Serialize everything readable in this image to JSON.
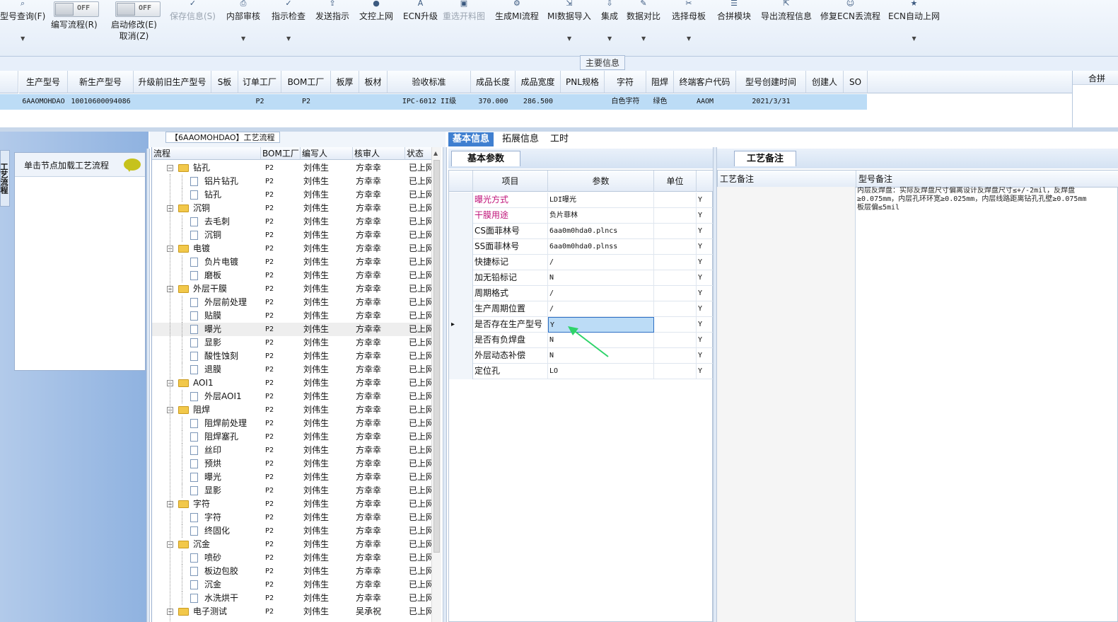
{
  "toolbar": {
    "items": [
      {
        "label": "型号查询(F)",
        "icon": "search-icon",
        "dropdown": true,
        "disabled": false
      },
      {
        "label": "编写流程(R)",
        "icon": "toggle-switch",
        "dropdown": false,
        "disabled": false,
        "toggle": "OFF"
      },
      {
        "label": "启动修改(E)",
        "label2": "取消(Z)",
        "icon": "toggle-switch",
        "dropdown": false,
        "disabled": false,
        "toggle": "OFF"
      },
      {
        "label": "保存信息(S)",
        "icon": "check-icon",
        "dropdown": false,
        "disabled": true
      },
      {
        "label": "内部审核",
        "icon": "print-icon",
        "dropdown": true,
        "disabled": false
      },
      {
        "label": "指示检查",
        "icon": "check-icon",
        "dropdown": true,
        "disabled": false
      },
      {
        "label": "发送指示",
        "icon": "upload-icon",
        "dropdown": false,
        "disabled": false
      },
      {
        "label": "文控上网",
        "icon": "lock-icon",
        "dropdown": false,
        "disabled": false
      },
      {
        "label": "ECN升级",
        "icon": "font-icon",
        "dropdown": false,
        "disabled": false
      },
      {
        "label": "重选开料图",
        "icon": "image-icon",
        "dropdown": false,
        "disabled": true
      },
      {
        "label": "生成MI流程",
        "icon": "settings-icon",
        "dropdown": false,
        "disabled": false
      },
      {
        "label": "MI数据导入",
        "icon": "import-icon",
        "dropdown": true,
        "disabled": false
      },
      {
        "label": "集成",
        "icon": "download-icon",
        "dropdown": true,
        "disabled": false
      },
      {
        "label": "数据对比",
        "icon": "pin-icon",
        "dropdown": true,
        "disabled": false
      },
      {
        "label": "选择母板",
        "icon": "tool-icon",
        "dropdown": true,
        "disabled": false
      },
      {
        "label": "合拼模块",
        "icon": "list-icon",
        "dropdown": false,
        "disabled": false
      },
      {
        "label": "导出流程信息",
        "icon": "export-icon",
        "dropdown": false,
        "disabled": false
      },
      {
        "label": "修复ECN丢流程",
        "icon": "smile-icon",
        "dropdown": false,
        "disabled": false
      },
      {
        "label": "ECN自动上网",
        "icon": "star-icon",
        "dropdown": true,
        "disabled": false
      }
    ]
  },
  "main_info_label": "主要信息",
  "top_grid": {
    "headers": [
      "生产型号",
      "新生产型号",
      "升级前旧生产型号",
      "S板",
      "订单工厂",
      "BOM工厂",
      "板厚",
      "板材",
      "验收标准",
      "成品长度",
      "成品宽度",
      "PNL规格",
      "字符",
      "阻焊",
      "终端客户代码",
      "型号创建时间",
      "创建人",
      "SO"
    ],
    "row": [
      "6AAOMOHDAO",
      "10010600094086",
      "",
      "",
      "P2",
      "P2",
      "",
      "",
      "IPC-6012 II级",
      "370.000",
      "286.500",
      "",
      "白色字符",
      "绿色",
      "AAOM",
      "2021/3/31",
      "",
      ""
    ]
  },
  "right_stub_header": "合拼",
  "left_panel": {
    "vertical_tab": "工艺流程",
    "load_hint": "单击节点加载工艺流程"
  },
  "tree_panel": {
    "title": "【6AAOMOHDAO】工艺流程",
    "headers": [
      "流程",
      "BOM工厂",
      "编写人",
      "核审人",
      "状态"
    ],
    "rows": [
      {
        "name": "钻孔",
        "level": 0,
        "bom": "P2",
        "writer": "刘伟生",
        "reviewer": "方幸幸",
        "status": "已上网"
      },
      {
        "name": "铝片钻孔",
        "level": 1,
        "bom": "P2",
        "writer": "刘伟生",
        "reviewer": "方幸幸",
        "status": "已上网"
      },
      {
        "name": "钻孔",
        "level": 1,
        "bom": "P2",
        "writer": "刘伟生",
        "reviewer": "方幸幸",
        "status": "已上网"
      },
      {
        "name": "沉铜",
        "level": 0,
        "bom": "P2",
        "writer": "刘伟生",
        "reviewer": "方幸幸",
        "status": "已上网"
      },
      {
        "name": "去毛刺",
        "level": 1,
        "bom": "P2",
        "writer": "刘伟生",
        "reviewer": "方幸幸",
        "status": "已上网"
      },
      {
        "name": "沉铜",
        "level": 1,
        "bom": "P2",
        "writer": "刘伟生",
        "reviewer": "方幸幸",
        "status": "已上网"
      },
      {
        "name": "电镀",
        "level": 0,
        "bom": "P2",
        "writer": "刘伟生",
        "reviewer": "方幸幸",
        "status": "已上网"
      },
      {
        "name": "负片电镀",
        "level": 1,
        "bom": "P2",
        "writer": "刘伟生",
        "reviewer": "方幸幸",
        "status": "已上网"
      },
      {
        "name": "磨板",
        "level": 1,
        "bom": "P2",
        "writer": "刘伟生",
        "reviewer": "方幸幸",
        "status": "已上网"
      },
      {
        "name": "外层干膜",
        "level": 0,
        "bom": "P2",
        "writer": "刘伟生",
        "reviewer": "方幸幸",
        "status": "已上网"
      },
      {
        "name": "外层前处理",
        "level": 1,
        "bom": "P2",
        "writer": "刘伟生",
        "reviewer": "方幸幸",
        "status": "已上网"
      },
      {
        "name": "贴膜",
        "level": 1,
        "bom": "P2",
        "writer": "刘伟生",
        "reviewer": "方幸幸",
        "status": "已上网"
      },
      {
        "name": "曝光",
        "level": 1,
        "bom": "P2",
        "writer": "刘伟生",
        "reviewer": "方幸幸",
        "status": "已上网",
        "selected": true
      },
      {
        "name": "显影",
        "level": 1,
        "bom": "P2",
        "writer": "刘伟生",
        "reviewer": "方幸幸",
        "status": "已上网"
      },
      {
        "name": "酸性蚀刻",
        "level": 1,
        "bom": "P2",
        "writer": "刘伟生",
        "reviewer": "方幸幸",
        "status": "已上网"
      },
      {
        "name": "退膜",
        "level": 1,
        "bom": "P2",
        "writer": "刘伟生",
        "reviewer": "方幸幸",
        "status": "已上网"
      },
      {
        "name": "AOI1",
        "level": 0,
        "bom": "P2",
        "writer": "刘伟生",
        "reviewer": "方幸幸",
        "status": "已上网"
      },
      {
        "name": "外层AOI1",
        "level": 1,
        "bom": "P2",
        "writer": "刘伟生",
        "reviewer": "方幸幸",
        "status": "已上网"
      },
      {
        "name": "阻焊",
        "level": 0,
        "bom": "P2",
        "writer": "刘伟生",
        "reviewer": "方幸幸",
        "status": "已上网"
      },
      {
        "name": "阻焊前处理",
        "level": 1,
        "bom": "P2",
        "writer": "刘伟生",
        "reviewer": "方幸幸",
        "status": "已上网"
      },
      {
        "name": "阻焊塞孔",
        "level": 1,
        "bom": "P2",
        "writer": "刘伟生",
        "reviewer": "方幸幸",
        "status": "已上网"
      },
      {
        "name": "丝印",
        "level": 1,
        "bom": "P2",
        "writer": "刘伟生",
        "reviewer": "方幸幸",
        "status": "已上网"
      },
      {
        "name": "预烘",
        "level": 1,
        "bom": "P2",
        "writer": "刘伟生",
        "reviewer": "方幸幸",
        "status": "已上网"
      },
      {
        "name": "曝光",
        "level": 1,
        "bom": "P2",
        "writer": "刘伟生",
        "reviewer": "方幸幸",
        "status": "已上网"
      },
      {
        "name": "显影",
        "level": 1,
        "bom": "P2",
        "writer": "刘伟生",
        "reviewer": "方幸幸",
        "status": "已上网"
      },
      {
        "name": "字符",
        "level": 0,
        "bom": "P2",
        "writer": "刘伟生",
        "reviewer": "方幸幸",
        "status": "已上网"
      },
      {
        "name": "字符",
        "level": 1,
        "bom": "P2",
        "writer": "刘伟生",
        "reviewer": "方幸幸",
        "status": "已上网"
      },
      {
        "name": "终固化",
        "level": 1,
        "bom": "P2",
        "writer": "刘伟生",
        "reviewer": "方幸幸",
        "status": "已上网"
      },
      {
        "name": "沉金",
        "level": 0,
        "bom": "P2",
        "writer": "刘伟生",
        "reviewer": "方幸幸",
        "status": "已上网"
      },
      {
        "name": "喷砂",
        "level": 1,
        "bom": "P2",
        "writer": "刘伟生",
        "reviewer": "方幸幸",
        "status": "已上网"
      },
      {
        "name": "板边包胶",
        "level": 1,
        "bom": "P2",
        "writer": "刘伟生",
        "reviewer": "方幸幸",
        "status": "已上网"
      },
      {
        "name": "沉金",
        "level": 1,
        "bom": "P2",
        "writer": "刘伟生",
        "reviewer": "方幸幸",
        "status": "已上网"
      },
      {
        "name": "水洗烘干",
        "level": 1,
        "bom": "P2",
        "writer": "刘伟生",
        "reviewer": "方幸幸",
        "status": "已上网"
      },
      {
        "name": "电子测试",
        "level": 0,
        "bom": "P2",
        "writer": "刘伟生",
        "reviewer": "吴承祝",
        "status": "已上网"
      }
    ]
  },
  "mid_tabs": [
    "基本信息",
    "拓展信息",
    "工时"
  ],
  "basic_params": {
    "tab_label": "基本参数",
    "headers": [
      "项目",
      "参数",
      "单位"
    ],
    "rows": [
      {
        "item": "曝光方式",
        "value": "LDI曝光",
        "unit": "",
        "flag": "Y",
        "highlight": true
      },
      {
        "item": "干膜用途",
        "value": "负片菲林",
        "unit": "",
        "flag": "Y",
        "highlight": true
      },
      {
        "item": "CS面菲林号",
        "value": "6aa0m0hda0.plncs",
        "unit": "",
        "flag": "Y"
      },
      {
        "item": "SS面菲林号",
        "value": "6aa0m0hda0.plnss",
        "unit": "",
        "flag": "Y"
      },
      {
        "item": "快捷标记",
        "value": "/",
        "unit": "",
        "flag": "Y"
      },
      {
        "item": "加无铅标记",
        "value": "N",
        "unit": "",
        "flag": "Y"
      },
      {
        "item": "周期格式",
        "value": "/",
        "unit": "",
        "flag": "Y"
      },
      {
        "item": "生产周期位置",
        "value": "/",
        "unit": "",
        "flag": "Y"
      },
      {
        "item": "是否存在生产型号",
        "value": "Y",
        "unit": "",
        "flag": "Y",
        "selected": true
      },
      {
        "item": "是否有负焊盘",
        "value": "N",
        "unit": "",
        "flag": "Y"
      },
      {
        "item": "外层动态补偿",
        "value": "N",
        "unit": "",
        "flag": "Y"
      },
      {
        "item": "定位孔",
        "value": "LO",
        "unit": "",
        "flag": "Y"
      }
    ]
  },
  "notes_panel": {
    "tab_label": "工艺备注",
    "headers": [
      "工艺备注",
      "型号备注"
    ],
    "model_note": "内层反焊盘：实际反焊盘尺寸偏离设计反焊盘尺寸≤+/-2mil，反焊盘\n≥0.075mm，内层孔环环宽≥0.025mm，内层线路距离钻孔孔壁≥0.075mm\n板层偏≤5mil"
  },
  "colors": {
    "accent": "#3f7fd0",
    "selection": "#bcdcf6",
    "highlight_text": "#c0147a",
    "arrow": "#2ed36a"
  }
}
